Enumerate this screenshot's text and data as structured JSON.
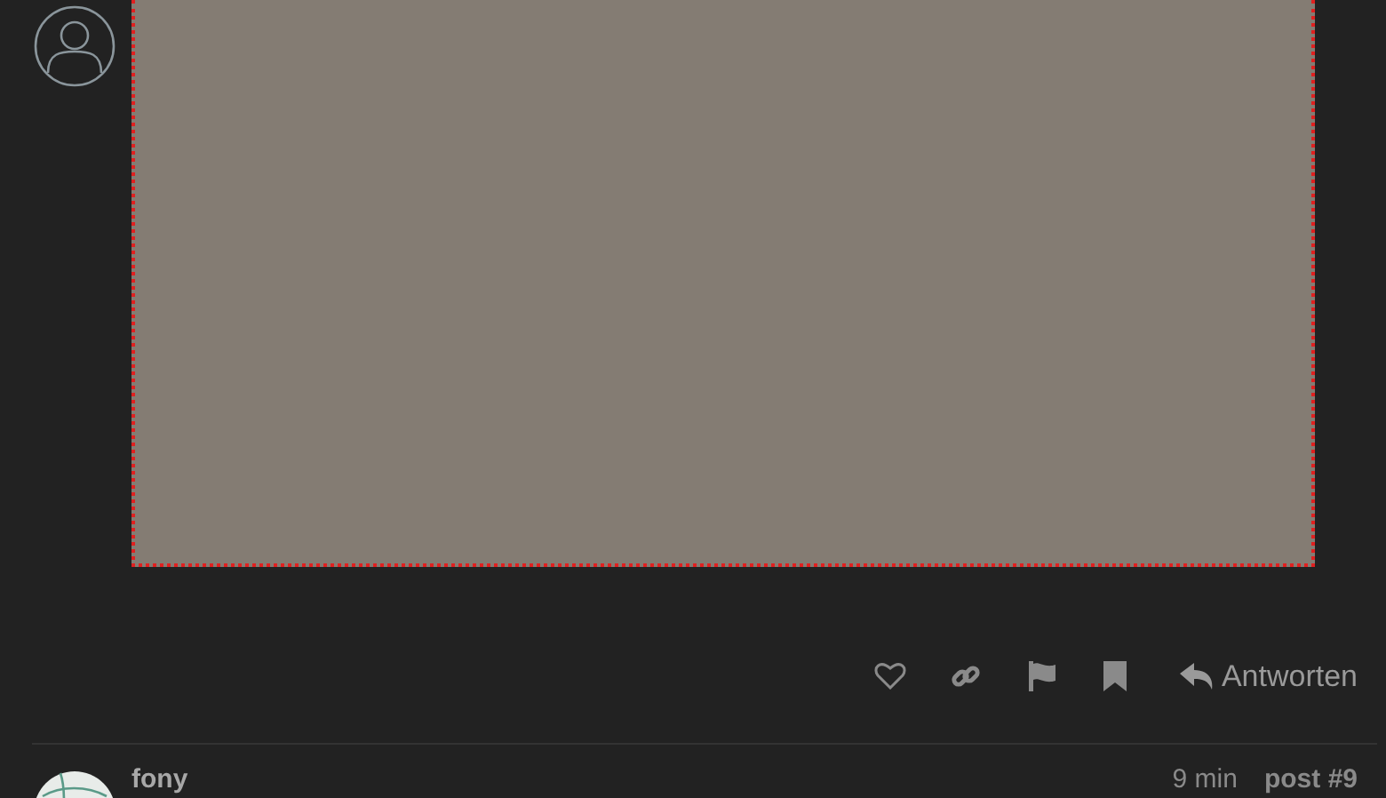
{
  "post": {
    "reply_button": "Antworten"
  },
  "next_post": {
    "username": "fony",
    "time": "9 min",
    "post_number": "post #9"
  }
}
